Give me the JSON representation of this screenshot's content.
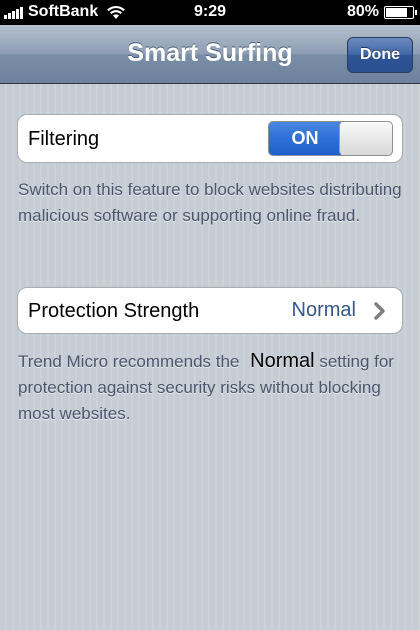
{
  "status_bar": {
    "carrier": "SoftBank",
    "time": "9:29",
    "battery": "80%",
    "battery_level": 0.8
  },
  "navbar": {
    "title": "Smart Surfing",
    "done_label": "Done"
  },
  "filtering": {
    "label": "Filtering",
    "toggle_label": "ON",
    "enabled": true,
    "description": "Switch on this feature to block websites distributing malicious software or supporting online fraud."
  },
  "protection": {
    "label": "Protection Strength",
    "value": "Normal"
  },
  "recommendation": {
    "text_before": "Trend Micro recommends the",
    "highlight": "Normal",
    "text_after": "setting for protection against security risks without blocking most websites."
  },
  "colors": {
    "accent_blue": "#2f6fd8",
    "value_text": "#35578a",
    "nav_bar": "#8d9db3"
  }
}
